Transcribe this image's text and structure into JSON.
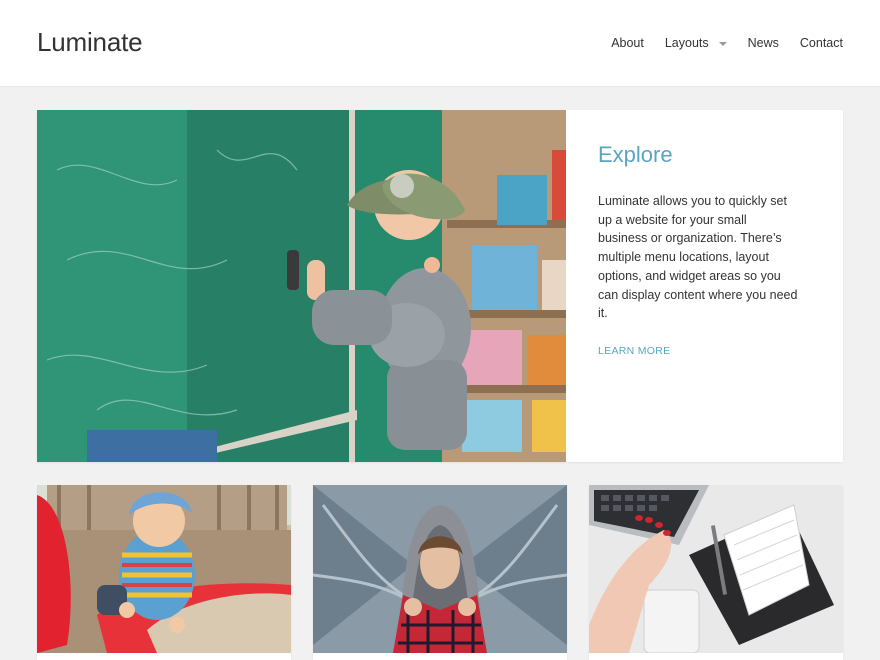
{
  "site": {
    "title": "Luminate"
  },
  "nav": {
    "items": [
      {
        "label": "About"
      },
      {
        "label": "Layouts",
        "has_dropdown": true,
        "icon": "chevron-down-icon"
      },
      {
        "label": "News"
      },
      {
        "label": "Contact"
      }
    ]
  },
  "hero": {
    "title": "Explore",
    "body": "Luminate allows you to quickly set up a website for your small business or organization. There’s multiple menu locations, layout options, and widget areas so you can display content where you need it.",
    "link_label": "LEARN MORE"
  },
  "cards": [
    {
      "image": "child-playing-sandbox-photo"
    },
    {
      "image": "woman-hood-scarf-photo"
    },
    {
      "image": "desk-laptop-notebook-photo"
    }
  ],
  "colors": {
    "accent": "#5aa6c2",
    "background": "#f1f1f1",
    "header_bg": "#ffffff",
    "text": "#333333"
  }
}
